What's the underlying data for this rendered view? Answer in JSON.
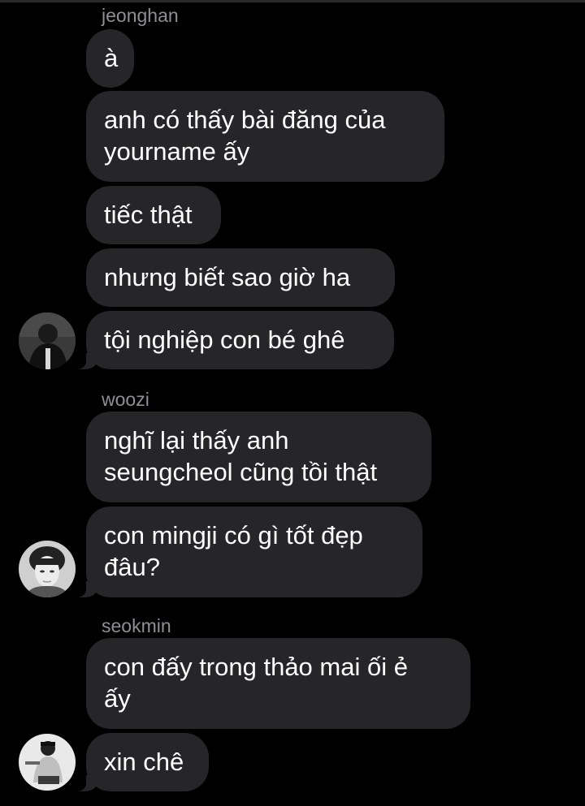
{
  "conversation": {
    "groups": [
      {
        "sender": "jeonghan",
        "messages": [
          "à",
          "anh có thấy bài đăng của\nyourname ấy",
          "tiếc thật",
          "nhưng biết sao giờ ha",
          "tội nghiệp con bé ghê"
        ]
      },
      {
        "sender": "woozi",
        "messages": [
          "nghĩ lại thấy anh\nseungcheol cũng tồi thật",
          "con mingji có gì tốt đẹp\nđâu?"
        ]
      },
      {
        "sender": "seokmin",
        "messages": [
          "con đấy trong thảo mai ối ẻ\nấy",
          "xin chê"
        ]
      }
    ]
  },
  "colors": {
    "background": "#000000",
    "bubble": "#262628",
    "sender_name": "#8e8e93",
    "message_text": "#ffffff"
  }
}
